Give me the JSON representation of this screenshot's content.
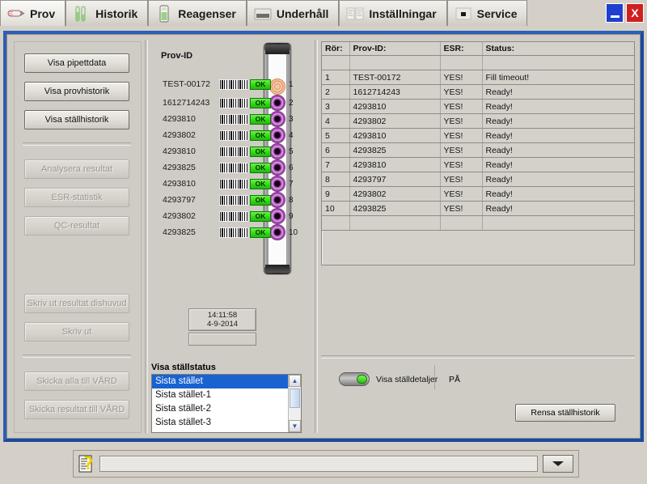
{
  "window": {
    "minimize_label": "",
    "close_label": "X"
  },
  "tabs": [
    {
      "label": "Prov",
      "icon": "pipette-icon",
      "active": true
    },
    {
      "label": "Historik",
      "icon": "tubes-icon",
      "active": false
    },
    {
      "label": "Reagenser",
      "icon": "reagent-bottle-icon",
      "active": false
    },
    {
      "label": "Underhåll",
      "icon": "maintenance-icon",
      "active": false
    },
    {
      "label": "Inställningar",
      "icon": "settings-list-icon",
      "active": false
    },
    {
      "label": "Service",
      "icon": "service-icon",
      "active": false
    }
  ],
  "sidebar": {
    "buttons": [
      {
        "label": "Visa pipettdata",
        "disabled": false
      },
      {
        "label": "Visa provhistorik",
        "disabled": false
      },
      {
        "label": "Visa ställhistorik",
        "disabled": false
      },
      {
        "label": "Analysera resultat",
        "disabled": true
      },
      {
        "label": "ESR-statistik",
        "disabled": true
      },
      {
        "label": "QC-resultat",
        "disabled": true
      },
      {
        "label": "Skriv ut resultat dishuvud",
        "disabled": true
      },
      {
        "label": "Skriv ut",
        "disabled": true
      },
      {
        "label": "Skicka alla till VÅRD",
        "disabled": true
      },
      {
        "label": "Skicka resultat till VÅRD",
        "disabled": true
      }
    ]
  },
  "samples": {
    "title": "Prov-ID",
    "ok_label": "OK",
    "rows": [
      {
        "id": "TEST-00172",
        "status": "OK",
        "well": "1",
        "tube_color": "orange"
      },
      {
        "id": "1612714243",
        "status": "OK",
        "well": "2",
        "tube_color": "purple"
      },
      {
        "id": "4293810",
        "status": "OK",
        "well": "3",
        "tube_color": "purple"
      },
      {
        "id": "4293802",
        "status": "OK",
        "well": "4",
        "tube_color": "purple"
      },
      {
        "id": "4293810",
        "status": "OK",
        "well": "5",
        "tube_color": "purple"
      },
      {
        "id": "4293825",
        "status": "OK",
        "well": "6",
        "tube_color": "purple"
      },
      {
        "id": "4293810",
        "status": "OK",
        "well": "7",
        "tube_color": "purple"
      },
      {
        "id": "4293797",
        "status": "OK",
        "well": "8",
        "tube_color": "purple"
      },
      {
        "id": "4293802",
        "status": "OK",
        "well": "9",
        "tube_color": "purple"
      },
      {
        "id": "4293825",
        "status": "OK",
        "well": "10",
        "tube_color": "purple"
      }
    ]
  },
  "clock": {
    "time": "14:11:58",
    "date": "4-9-2014",
    "secondary_value": ""
  },
  "rack_status": {
    "label": "Visa ställstatus",
    "options": [
      {
        "label": "Sista stället",
        "selected": true
      },
      {
        "label": "Sista stället-1",
        "selected": false
      },
      {
        "label": "Sista stället-2",
        "selected": false
      },
      {
        "label": "Sista stället-3",
        "selected": false
      }
    ]
  },
  "table": {
    "columns": [
      "Rör:",
      "Prov-ID:",
      "ESR:",
      "Status:"
    ],
    "rows": [
      [
        "",
        "",
        "",
        ""
      ],
      [
        "1",
        "TEST-00172",
        "YES!",
        "Fill timeout!"
      ],
      [
        "2",
        "1612714243",
        "YES!",
        "Ready!"
      ],
      [
        "3",
        "4293810",
        "YES!",
        "Ready!"
      ],
      [
        "4",
        "4293802",
        "YES!",
        "Ready!"
      ],
      [
        "5",
        "4293810",
        "YES!",
        "Ready!"
      ],
      [
        "6",
        "4293825",
        "YES!",
        "Ready!"
      ],
      [
        "7",
        "4293810",
        "YES!",
        "Ready!"
      ],
      [
        "8",
        "4293797",
        "YES!",
        "Ready!"
      ],
      [
        "9",
        "4293802",
        "YES!",
        "Ready!"
      ],
      [
        "10",
        "4293825",
        "YES!",
        "Ready!"
      ],
      [
        "",
        "",
        "",
        ""
      ]
    ]
  },
  "details": {
    "toggle_label": "Visa ställdetaljer",
    "toggle_state": "PÅ",
    "clear_button": "Rensa ställhistorik"
  },
  "statusbar": {
    "icon": "note-help-icon",
    "value": "",
    "placeholder": "",
    "dropdown_icon": "chevron-down-icon"
  },
  "colors": {
    "accent_blue": "#1b4a9c",
    "selection_blue": "#1962d0",
    "ok_green": "#33d914",
    "close_red": "#cf1f1f",
    "panel_gray": "#cfccc6"
  }
}
